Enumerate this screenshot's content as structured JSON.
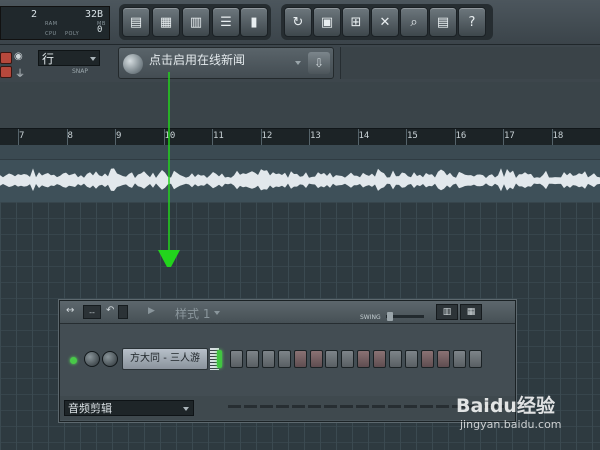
{
  "meter": {
    "a": "2",
    "b": "32B",
    "c": "RAM",
    "d": "MB",
    "e": "CPU",
    "f": "POLY",
    "g": "0"
  },
  "toolbar": {
    "icons": [
      "playlist-icon",
      "step-sequencer-icon",
      "piano-roll-icon",
      "browser-icon",
      "mixer-icon",
      "undo-icon",
      "save-icon",
      "render-icon",
      "tools-icon",
      "search-icon",
      "document-icon",
      "help-icon"
    ],
    "help_label": "?"
  },
  "snap": {
    "value": "行",
    "label": "SNAP"
  },
  "news": {
    "text": "点击启用在线新闻"
  },
  "ruler": {
    "ticks": [
      "7",
      "8",
      "9",
      "10",
      "11",
      "12",
      "13",
      "14",
      "15",
      "16",
      "17",
      "18"
    ]
  },
  "pattern": {
    "name": "样式 1",
    "swing_label": "SWING",
    "channel_name": "方大同 - 三人游",
    "steps": [
      "a",
      "a",
      "a",
      "a",
      "b",
      "b",
      "a",
      "a",
      "b",
      "b",
      "a",
      "a",
      "b",
      "b",
      "a",
      "a"
    ],
    "selector": "音频剪辑",
    "mode_label": "--"
  },
  "watermark": {
    "brand": "Baidu经验",
    "url": "jingyan.baidu.com"
  },
  "colors": {
    "accent_green": "#48c948",
    "arrow_green": "#22d41c"
  }
}
